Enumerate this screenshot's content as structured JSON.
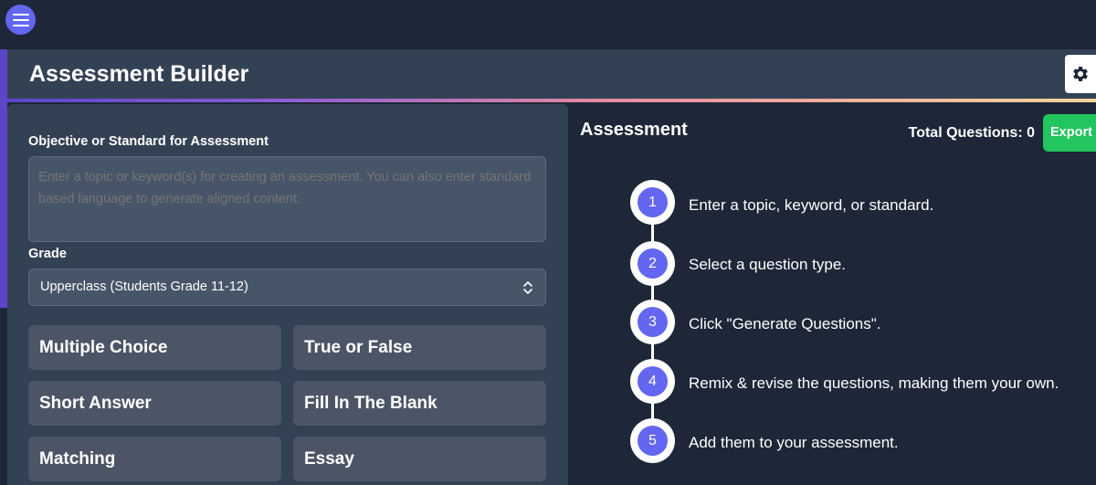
{
  "header": {
    "title": "Assessment Builder"
  },
  "form": {
    "objective_label": "Objective or Standard for Assessment",
    "objective_placeholder": "Enter a topic or keyword(s) for creating an assessment. You can also enter standard based language to generate aligned content.",
    "grade_label": "Grade",
    "grade_value": "Upperclass (Students Grade 11-12)"
  },
  "question_types": [
    "Multiple Choice",
    "True or False",
    "Short Answer",
    "Fill In The Blank",
    "Matching",
    "Essay"
  ],
  "assessment": {
    "title": "Assessment",
    "total_label": "Total Questions: 0",
    "export_label": "Export"
  },
  "steps": [
    {
      "num": "1",
      "text": "Enter a topic, keyword, or standard."
    },
    {
      "num": "2",
      "text": "Select a question type."
    },
    {
      "num": "3",
      "text": "Click \"Generate Questions\"."
    },
    {
      "num": "4",
      "text": "Remix & revise the questions, making them your own."
    },
    {
      "num": "5",
      "text": "Add them to your assessment."
    }
  ],
  "colors": {
    "background": "#1d2738",
    "panel": "#334155",
    "accent": "#6366f1",
    "export": "#22c55e"
  },
  "icons": [
    "menu-icon",
    "gear-icon",
    "select-arrows-icon"
  ]
}
